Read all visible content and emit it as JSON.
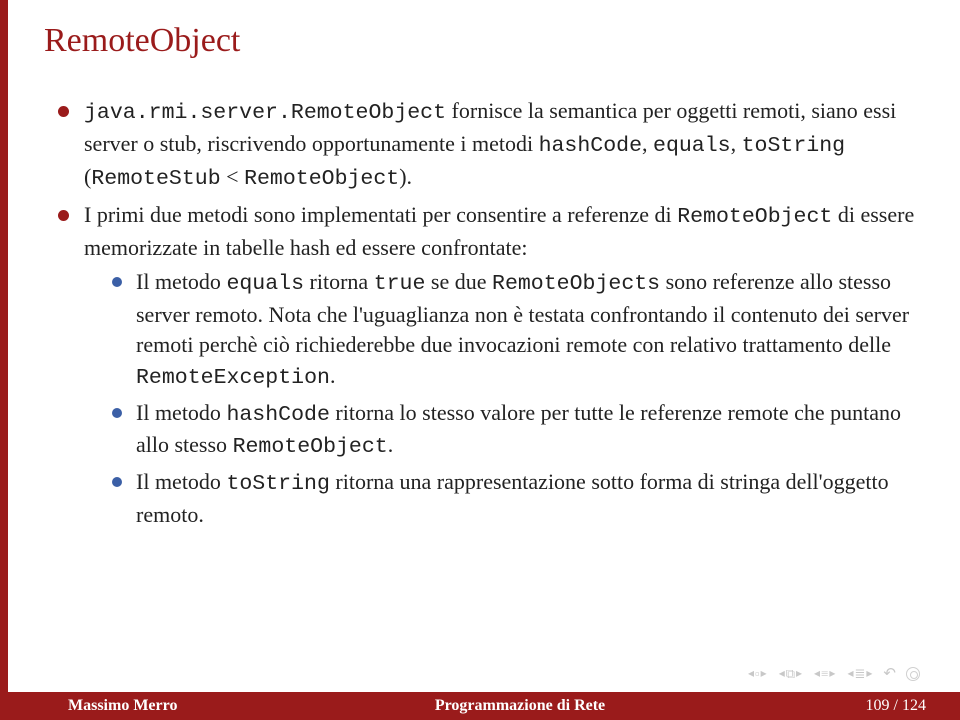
{
  "title": "RemoteObject",
  "bullets": {
    "b1_pre": "",
    "b1_code1": "java.rmi.server.RemoteObject",
    "b1_mid": " fornisce la semantica per oggetti remoti, siano essi server o stub, riscrivendo opportunamente i metodi ",
    "b1_code2": "hashCode",
    "b1_sep1": ", ",
    "b1_code3": "equals",
    "b1_sep2": ", ",
    "b1_code4": "toString",
    "b1_open": " (",
    "b1_code5": "RemoteStub",
    "b1_lt": " < ",
    "b1_code6": "RemoteObject",
    "b1_close": ").",
    "b2_pre": "I primi due metodi sono implementati per consentire a referenze di ",
    "b2_code1": "RemoteObject",
    "b2_post": " di essere memorizzate in tabelle hash ed essere confrontate:",
    "s1_pre": "Il metodo ",
    "s1_code1": "equals",
    "s1_mid1": " ritorna ",
    "s1_code2": "true",
    "s1_mid2": " se due ",
    "s1_code3": "RemoteObjects",
    "s1_mid3": " sono referenze allo stesso server remoto. Nota che l'uguaglianza non è testata confrontando il contenuto dei server remoti perchè ciò richiederebbe due invocazioni remote con relativo trattamento delle ",
    "s1_code4": "RemoteException",
    "s1_end": ".",
    "s2_pre": "Il metodo ",
    "s2_code1": "hashCode",
    "s2_mid": " ritorna lo stesso valore per tutte le referenze remote che puntano allo stesso ",
    "s2_code2": "RemoteObject",
    "s2_end": ".",
    "s3_pre": "Il metodo ",
    "s3_code1": "toString",
    "s3_post": " ritorna una rappresentazione sotto forma di stringa dell'oggetto remoto."
  },
  "footer": {
    "author": "Massimo Merro",
    "ptitle": "Programmazione di Rete",
    "pages": "109 / 124"
  }
}
